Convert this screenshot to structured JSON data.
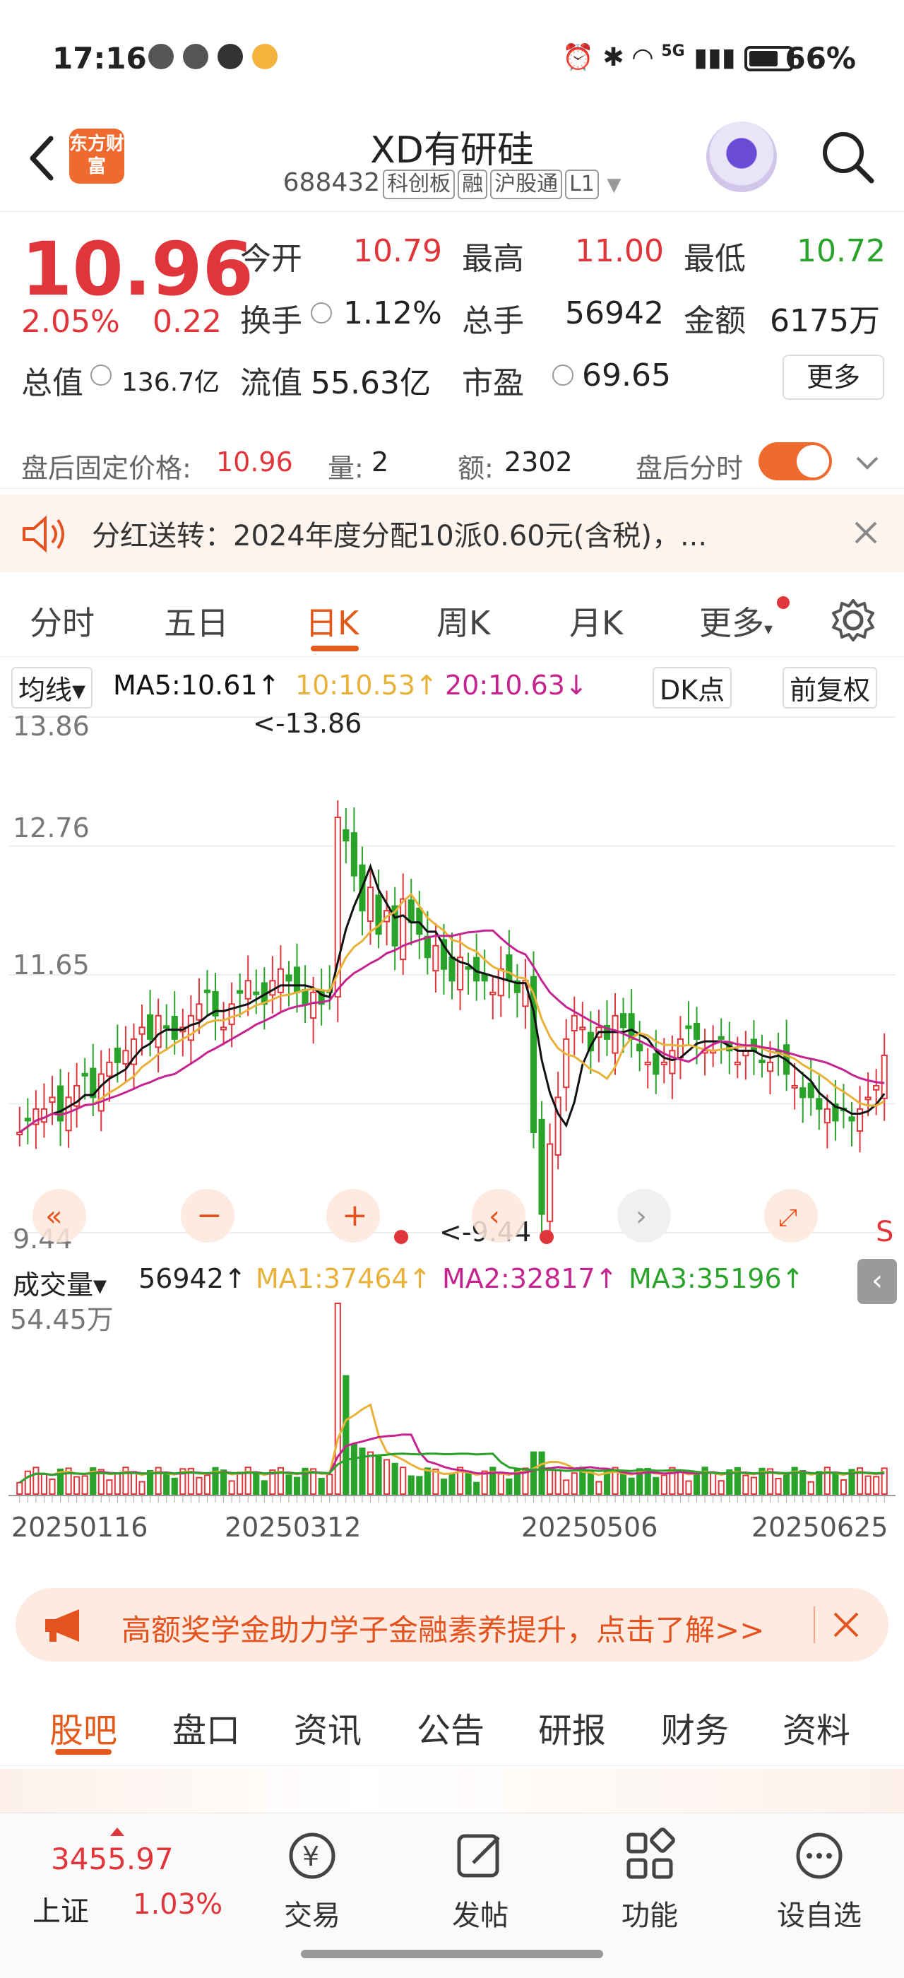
{
  "status_bar": {
    "time": "17:16",
    "battery": "66%",
    "network": "5G"
  },
  "header": {
    "brand": "东方财富",
    "stock_name": "XD有研硅",
    "code": "688432",
    "tags": [
      "科创板",
      "融",
      "沪股通",
      "L1"
    ]
  },
  "quote": {
    "price": "10.96",
    "pct": "2.05%",
    "change": "0.22",
    "fields": [
      {
        "label": "今开",
        "value": "10.79",
        "tone": "red"
      },
      {
        "label": "最高",
        "value": "11.00",
        "tone": "red"
      },
      {
        "label": "最低",
        "value": "10.72",
        "tone": "green"
      },
      {
        "label": "换手",
        "value": "1.12%",
        "tone": "plain"
      },
      {
        "label": "总手",
        "value": "56942",
        "tone": "plain"
      },
      {
        "label": "金额",
        "value": "6175万",
        "tone": "plain"
      },
      {
        "label": "总值",
        "value": "136.7亿",
        "tone": "plain"
      },
      {
        "label": "流值",
        "value": "55.63亿",
        "tone": "plain"
      },
      {
        "label": "市盈",
        "value": "69.65",
        "tone": "plain"
      }
    ],
    "more_label": "更多",
    "after_hours": {
      "label": "盘后固定价格:",
      "price": "10.96",
      "vol_label": "量:",
      "vol": "2",
      "amt_label": "额:",
      "amt": "2302",
      "toggle_label": "盘后分时",
      "toggle_on": true
    }
  },
  "notice": {
    "text": "分红送转：2024年度分配10派0.60元(含税)，..."
  },
  "chart_tabs": {
    "items": [
      "分时",
      "五日",
      "日K",
      "周K",
      "月K",
      "更多"
    ],
    "active": "日K"
  },
  "ma_row": {
    "selector": "均线",
    "ma5": "MA5:10.61↑",
    "ma10": "10:10.53↑",
    "ma20": "20:10.63↓",
    "dk": "DK点",
    "adjust": "前复权"
  },
  "kchart": {
    "price_labels": [
      "13.86",
      "12.76",
      "11.65",
      "9.44"
    ],
    "high_marker": "<-13.86",
    "low_marker": "<-9.44",
    "edge_letter": "S"
  },
  "volume_row": {
    "selector": "成交量",
    "current": "56942↑",
    "ma1": "MA1:37464↑",
    "ma2": "MA2:32817↑",
    "ma3": "MA3:35196↑"
  },
  "volchart": {
    "max_label": "54.45万",
    "dates": [
      "20250116",
      "20250312",
      "20250506",
      "20250625"
    ]
  },
  "chart_data": {
    "type": "candlestick",
    "title": "",
    "ylim": [
      9.44,
      13.86
    ],
    "x_ticks": [
      "20250116",
      "20250312",
      "20250506",
      "20250625"
    ],
    "ma_lines": [
      "MA5",
      "MA10",
      "MA20"
    ],
    "close_approx": [
      10.3,
      10.4,
      10.5,
      10.5,
      10.6,
      10.4,
      10.6,
      10.7,
      10.8,
      10.6,
      10.8,
      10.9,
      10.9,
      11.0,
      11.1,
      11.2,
      11.1,
      11.3,
      11.2,
      11.1,
      11.2,
      11.3,
      11.4,
      11.5,
      11.3,
      11.2,
      11.4,
      11.5,
      11.6,
      11.5,
      11.4,
      11.6,
      11.7,
      11.6,
      11.5,
      11.4,
      11.5,
      11.4,
      11.5,
      13.0,
      12.8,
      12.5,
      12.2,
      12.4,
      12.0,
      12.2,
      11.9,
      12.3,
      12.1,
      12.0,
      11.8,
      11.9,
      11.7,
      11.6,
      11.8,
      11.7,
      11.6,
      11.6,
      11.5,
      11.7,
      11.6,
      11.5,
      11.6,
      10.3,
      9.6,
      10.2,
      10.6,
      11.1,
      11.3,
      11.2,
      11.0,
      11.2,
      11.1,
      11.3,
      11.2,
      11.1,
      11.0,
      10.9,
      10.8,
      10.9,
      11.0,
      11.1,
      11.2,
      11.1,
      11.0,
      11.0,
      11.1,
      11.0,
      10.9,
      11.0,
      11.0,
      10.9,
      10.9,
      11.0,
      10.8,
      10.7,
      10.6,
      10.6,
      10.5,
      10.5,
      10.4,
      10.5,
      10.4,
      10.5,
      10.6,
      10.7,
      10.96
    ],
    "volume_max": "54.45万"
  },
  "promo": {
    "text": "高额奖学金助力学子金融素养提升，点击了解>>"
  },
  "info_tabs": {
    "items": [
      "股吧",
      "盘口",
      "资讯",
      "公告",
      "研报",
      "财务",
      "资料"
    ],
    "active": "股吧"
  },
  "index_ticker": {
    "value": "3455.97",
    "name": "上证",
    "pct": "1.03%"
  },
  "bottom_nav": [
    "交易",
    "发帖",
    "功能",
    "设自选"
  ],
  "colors": {
    "accent": "#e45a1a",
    "up": "#e0353a",
    "down": "#2aa32a",
    "ma5": "#111111",
    "ma10": "#e8b23a",
    "ma20": "#c4248f"
  }
}
